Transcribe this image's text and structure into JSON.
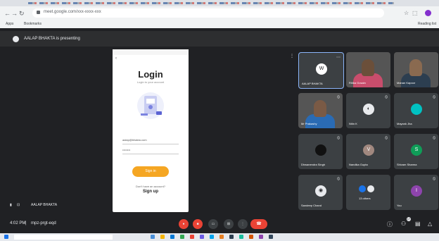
{
  "browser": {
    "url": "meet.google.com/xxx-xxxx-xxx",
    "bookmarks": [
      "Apps",
      "Bookmarks",
      "Reading list"
    ]
  },
  "meet": {
    "presenting_label": "AALAP BHAKTA is presenting",
    "self_name": "AALAP BHAKTA",
    "meeting_time": "4:02 PM",
    "meeting_code": "mpz-prgt-eqd",
    "people_count": "17"
  },
  "slide": {
    "title": "Login",
    "subtitle": "Login to your account",
    "email_value": "aalap@bhakta.com",
    "password_value": "••••••••",
    "button_label": "Sign in",
    "no_account": "Don't have an account?",
    "signup_label": "Sign up"
  },
  "participants": [
    {
      "name": "AALAP BHAKTA",
      "kind": "logo"
    },
    {
      "name": "Ritika Gosain",
      "kind": "video"
    },
    {
      "name": "Manan Kapoor",
      "kind": "video"
    },
    {
      "name": "Mr Prakashy",
      "kind": "video"
    },
    {
      "name": "Nitin K",
      "kind": "avatar"
    },
    {
      "name": "Mayank Jha",
      "kind": "avatar"
    },
    {
      "name": "Dhwanendra Singh",
      "kind": "avatar"
    },
    {
      "name": "Nandika Gupta",
      "kind": "avatar",
      "initial": "V"
    },
    {
      "name": "Shivam Sharma",
      "kind": "avatar",
      "initial": "S"
    },
    {
      "name": "Sandeep Chand",
      "kind": "avatar"
    },
    {
      "name": "13 others",
      "kind": "group"
    },
    {
      "name": "You",
      "kind": "avatar",
      "initial": "I"
    }
  ],
  "colors": {
    "accent_orange": "#f5a623",
    "hangup_red": "#ea4335",
    "meet_bg": "#202124",
    "tile_bg": "#3c4043"
  }
}
